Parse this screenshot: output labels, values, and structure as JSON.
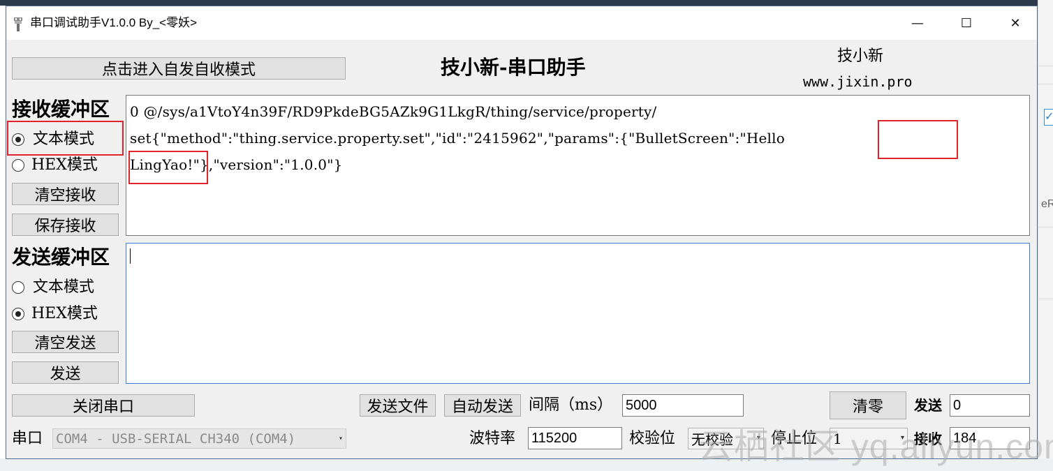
{
  "window": {
    "title": "串口调试助手V1.0.0 By_<零妖>",
    "controls": {
      "minimize": "—",
      "maximize": "☐",
      "close": "✕"
    }
  },
  "header": {
    "mode_button": "点击进入自发自收模式",
    "app_heading": "技小新-串口助手",
    "brand_name": "技小新",
    "brand_url": "www.jixin.pro"
  },
  "receive": {
    "heading": "接收缓冲区",
    "text_mode": "文本模式",
    "hex_mode": "HEX模式",
    "selected_mode": "文本模式",
    "clear_button": "清空接收",
    "save_button": "保存接收",
    "content_lines": [
      "0 @/sys/a1VtoY4n39F/RD9PkdeBG5AZk9G1LkgR/thing/service/property/",
      "set{\"method\":\"thing.service.property.set\",\"id\":\"2415962\",\"params\":{\"BulletScreen\":\"Hello",
      "LingYao!\"},\"version\":\"1.0.0\"}"
    ]
  },
  "send": {
    "heading": "发送缓冲区",
    "text_mode": "文本模式",
    "hex_mode": "HEX模式",
    "selected_mode": "HEX模式",
    "clear_button": "清空发送",
    "send_button": "发送",
    "content": ""
  },
  "controls": {
    "close_port_button": "关闭串口",
    "send_file_button": "发送文件",
    "auto_send_button": "自动发送",
    "interval_label": "间隔（ms）",
    "interval_value": "5000",
    "clear_count_button": "清零",
    "send_count_label": "发送",
    "send_count_value": "0",
    "port_label": "串口",
    "port_value": "COM4 - USB-SERIAL CH340 (COM4)",
    "baud_label": "波特率",
    "baud_value": "115200",
    "parity_label": "校验位",
    "parity_value": "无校验",
    "stopbits_label": "停止位",
    "stopbits_value": "1",
    "recv_count_label": "接收",
    "recv_count_value": "184"
  },
  "watermark": "云栖社区 yq.aliyun.com",
  "colors": {
    "highlight_box": "#e0232a",
    "window_bg": "#f0f0f0",
    "button_bg": "#e1e1e1"
  }
}
